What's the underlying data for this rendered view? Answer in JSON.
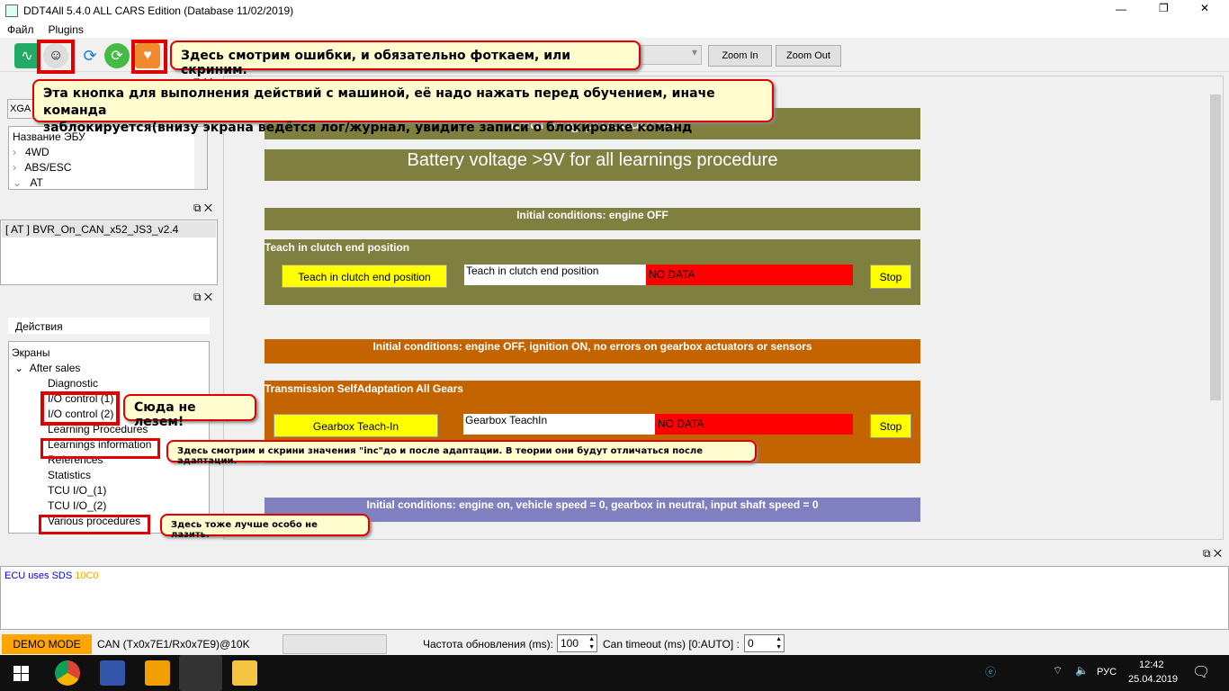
{
  "window": {
    "title": "DDT4All 5.4.0 ALL CARS Edition (Database 11/02/2019)",
    "minimize": "—",
    "maximize": "❐",
    "close": "✕"
  },
  "menu": {
    "items": [
      "Файл",
      "Plugins"
    ]
  },
  "toolbar": {
    "zoom_in": "Zoom In",
    "zoom_out": "Zoom Out",
    "icons": [
      "ecg-monitor-icon",
      "connect-face-icon",
      "refresh-icon",
      "green-refresh-icon",
      "heart-diagnostic-icon"
    ]
  },
  "callouts": {
    "errors": "Здесь смотрим ошибки, и обязательно фоткаем, или скриним.",
    "connect_line1": "Эта кнопка для выполнения действий с машиной, её надо нажать перед обучением, иначе команда",
    "connect_line2": "заблокируется(внизу экрана ведётся лог/журнал, увидите записи о блокировке команд",
    "io": "Сюда не лезем!",
    "learnings": "Здесь смотрим и скрини значения \"inc\"до и после адаптации. В теории они будут отличаться после адаптации.",
    "various": "Здесь тоже лучше особо не лазить."
  },
  "left": {
    "mode_select": "XGA",
    "ecu_tree": {
      "header": "Название ЭБУ",
      "items": [
        {
          "label": "4WD",
          "expanded": false
        },
        {
          "label": "ABS/ESC",
          "expanded": false
        },
        {
          "label": "AT",
          "expanded": true
        }
      ]
    },
    "ecu_list": [
      "[ AT ] BVR_On_CAN_x52_JS3_v2.4"
    ],
    "actions_label": "Действия",
    "screens": {
      "root": "Экраны",
      "group": "After sales",
      "items": [
        "Diagnostic",
        "I/O control (1)",
        "I/O control (2)",
        "Learning Procedures",
        "Learnings information",
        "References",
        "Statistics",
        "TCU I/O_(1)",
        "TCU I/O_(2)",
        "Various procedures"
      ]
    }
  },
  "main": {
    "title_band": "Learning procedures",
    "battery_band": "Battery voltage >9V for all learnings procedure",
    "section1": {
      "conditions": "Initial conditions: engine OFF",
      "title": "Teach in clutch end position",
      "button": "Teach in clutch end position",
      "field": "Teach in clutch end position",
      "value": "NO DATA",
      "stop": "Stop"
    },
    "section2": {
      "conditions": "Initial conditions: engine OFF, ignition ON, no errors on gearbox actuators or sensors",
      "title": "Transmission SelfAdaptation All Gears",
      "button": "Gearbox Teach-In",
      "field": "Gearbox TeachIn",
      "value": "NO DATA",
      "stop": "Stop"
    },
    "section3": {
      "conditions": "Initial conditions: engine on, vehicle speed = 0, gearbox in neutral, input shaft speed = 0"
    },
    "colors": {
      "olive": "#7f7f3f",
      "orange": "#c46400",
      "purple": "#8080c0",
      "button": "#ffff00",
      "nodata": "#ff0000"
    }
  },
  "log": {
    "text": "ECU uses SDS",
    "code": "10C0"
  },
  "status": {
    "mode": "DEMO MODE",
    "can": "CAN (Tx0x7E1/Rx0x7E9)@10K",
    "refresh_label": "Частота обновления (ms):",
    "refresh_value": "100",
    "timeout_label": "Can timeout (ms) [0:AUTO] :",
    "timeout_value": "0"
  },
  "taskbar": {
    "lang": "РУС",
    "time": "12:42",
    "date": "25.04.2019"
  }
}
